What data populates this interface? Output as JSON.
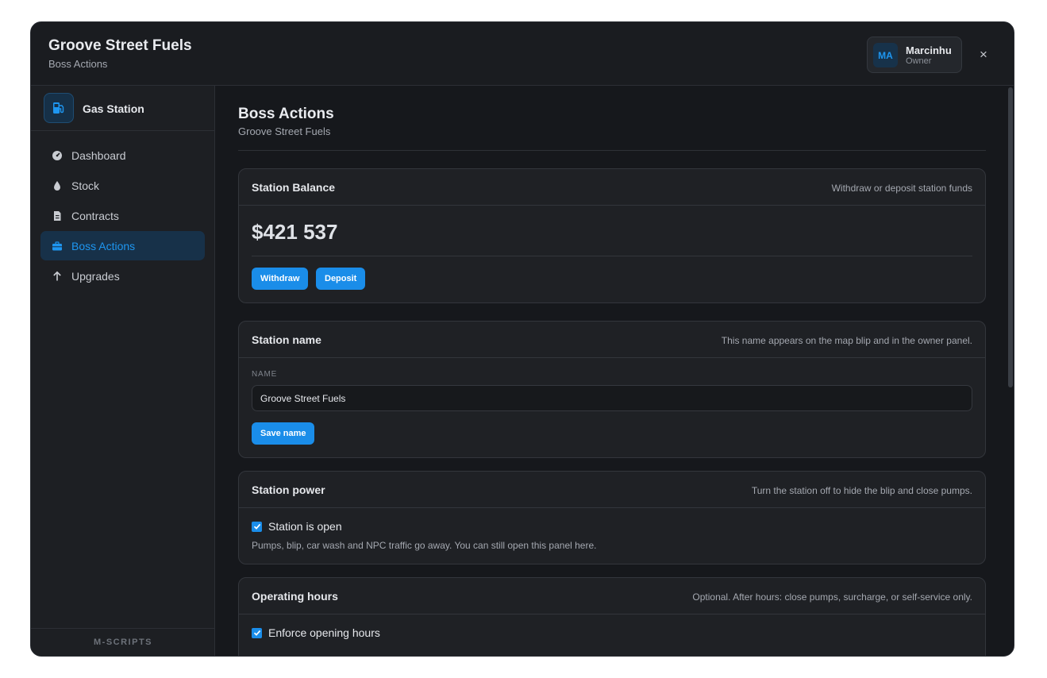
{
  "header": {
    "title": "Groove Street Fuels",
    "subtitle": "Boss Actions",
    "user": {
      "initials": "MA",
      "name": "Marcinhu",
      "role": "Owner"
    },
    "close_label": "×"
  },
  "sidebar": {
    "brand": "Gas Station",
    "items": [
      {
        "label": "Dashboard",
        "icon": "gauge-icon",
        "active": false
      },
      {
        "label": "Stock",
        "icon": "droplet-icon",
        "active": false
      },
      {
        "label": "Contracts",
        "icon": "document-icon",
        "active": false
      },
      {
        "label": "Boss Actions",
        "icon": "briefcase-icon",
        "active": true
      },
      {
        "label": "Upgrades",
        "icon": "arrow-up-icon",
        "active": false
      }
    ],
    "footer": "M-SCRIPTS"
  },
  "main": {
    "title": "Boss Actions",
    "subtitle": "Groove Street Fuels",
    "balance_card": {
      "title": "Station Balance",
      "hint": "Withdraw or deposit station funds",
      "amount": "$421 537",
      "withdraw_label": "Withdraw",
      "deposit_label": "Deposit"
    },
    "name_card": {
      "title": "Station name",
      "hint": "This name appears on the map blip and in the owner panel.",
      "field_label": "NAME",
      "value": "Groove Street Fuels",
      "save_label": "Save name"
    },
    "power_card": {
      "title": "Station power",
      "hint": "Turn the station off to hide the blip and close pumps.",
      "checkbox_label": "Station is open",
      "checked": true,
      "help": "Pumps, blip, car wash and NPC traffic go away. You can still open this panel here."
    },
    "hours_card": {
      "title": "Operating hours",
      "hint": "Optional. After hours: close pumps, surcharge, or self-service only.",
      "checkbox_label": "Enforce opening hours",
      "checked": true
    }
  },
  "colors": {
    "accent": "#1a8de9",
    "background": "#16181c",
    "panel": "#1f2125"
  }
}
